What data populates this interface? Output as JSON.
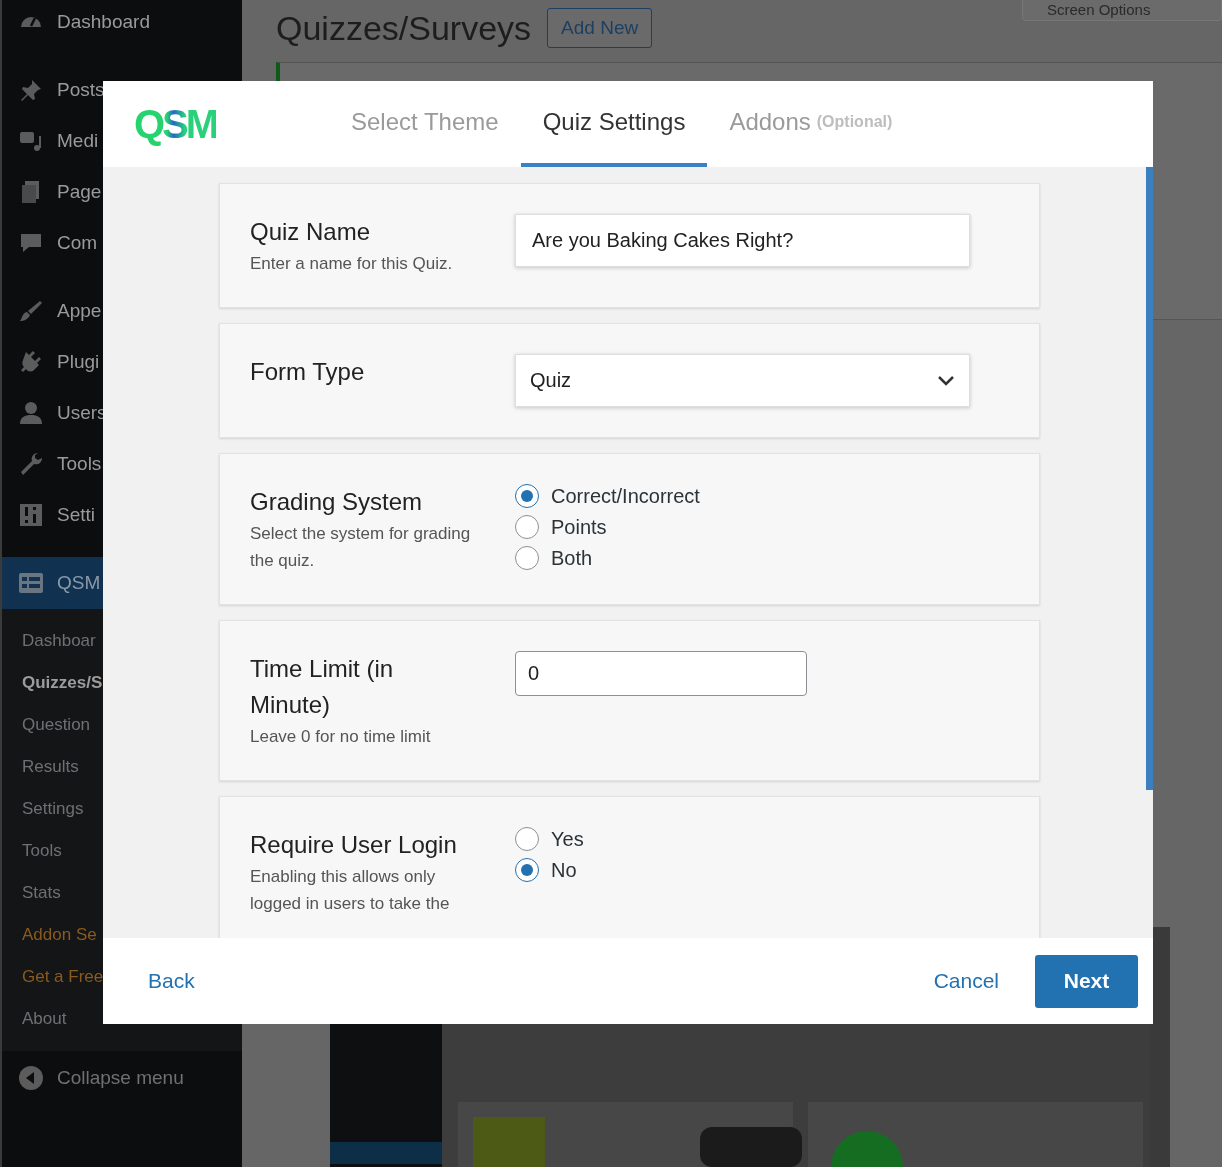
{
  "sidebar": {
    "groups": [
      {
        "items": [
          {
            "label": "Dashboard",
            "selected": false
          }
        ]
      },
      {
        "items": [
          {
            "label": "Posts",
            "selected": false
          },
          {
            "label": "Medi",
            "selected": false
          },
          {
            "label": "Page",
            "selected": false
          },
          {
            "label": "Com",
            "selected": false
          }
        ]
      },
      {
        "items": [
          {
            "label": "Appe",
            "selected": false
          },
          {
            "label": "Plugi",
            "selected": false
          },
          {
            "label": "Users",
            "selected": false
          },
          {
            "label": "Tools",
            "selected": false
          },
          {
            "label": "Setti",
            "selected": false
          }
        ]
      },
      {
        "items": [
          {
            "label": "QSM",
            "selected": true
          }
        ]
      }
    ],
    "submenu": [
      {
        "label": "Dashboar",
        "kind": "link",
        "selected": false
      },
      {
        "label": "Quizzes/S",
        "kind": "link",
        "selected": true
      },
      {
        "label": "Question",
        "kind": "link",
        "selected": false
      },
      {
        "label": "Results",
        "kind": "link",
        "selected": false
      },
      {
        "label": "Settings",
        "kind": "link",
        "selected": false
      },
      {
        "label": "Tools",
        "kind": "link",
        "selected": false
      },
      {
        "label": "Stats",
        "kind": "link",
        "selected": false
      },
      {
        "label": "Addon Se",
        "kind": "upsell",
        "selected": false
      },
      {
        "label": "Get a Free",
        "kind": "upsell",
        "selected": false
      },
      {
        "label": "About",
        "kind": "link",
        "selected": false
      }
    ],
    "collapse": "Collapse menu"
  },
  "page": {
    "title": "Quizzes/Surveys",
    "add_new": "Add New",
    "screen_options": "Screen Options"
  },
  "modal": {
    "logo": "QSM",
    "tabs": [
      {
        "label": "Select Theme",
        "selected": false
      },
      {
        "label": "Quiz Settings",
        "selected": true
      },
      {
        "label": "Addons",
        "note": "(Optional)",
        "selected": false
      }
    ],
    "fields": [
      {
        "kind": "text",
        "label": "Quiz Name",
        "description": "Enter a name for this Quiz.",
        "value": "Are you Baking Cakes Right?"
      },
      {
        "kind": "select",
        "label": "Form Type",
        "value": "Quiz"
      },
      {
        "kind": "radio",
        "label": "Grading System",
        "description": "Select the system for grading the quiz.",
        "options": [
          {
            "label": "Correct/Incorrect",
            "selected": true
          },
          {
            "label": "Points",
            "selected": false
          },
          {
            "label": "Both",
            "selected": false
          }
        ]
      },
      {
        "kind": "number",
        "label": "Time Limit (in Minute)",
        "description": "Leave 0 for no time limit",
        "value": "0"
      },
      {
        "kind": "radio",
        "label": "Require User Login",
        "description": "Enabling this allows only logged in users to take the",
        "options": [
          {
            "label": "Yes",
            "selected": false
          },
          {
            "label": "No",
            "selected": true
          }
        ]
      }
    ],
    "back": "Back",
    "cancel": "Cancel",
    "next": "Next"
  }
}
